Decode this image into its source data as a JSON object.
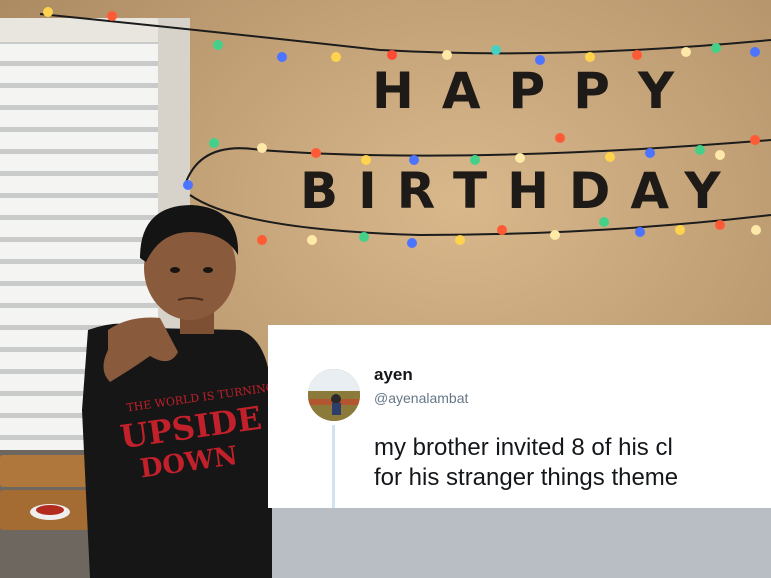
{
  "banner": {
    "line1": "HAPPY",
    "line2": "BIRTHDAY"
  },
  "shirt": {
    "line1": "THE WORLD IS TURNING",
    "line2": "UPSIDE",
    "line3": "DOWN"
  },
  "tweet": {
    "display_name": "ayen",
    "handle": "@ayenalambat",
    "text_line1": "my brother invited 8 of his cl",
    "text_line2": "for his stranger things theme"
  },
  "colors": {
    "wall": "#c8a57a",
    "shirt": "#161616",
    "shirt_print": "#c2202a",
    "card_bg": "#ffffff",
    "thread_line": "#cfe3f0"
  }
}
